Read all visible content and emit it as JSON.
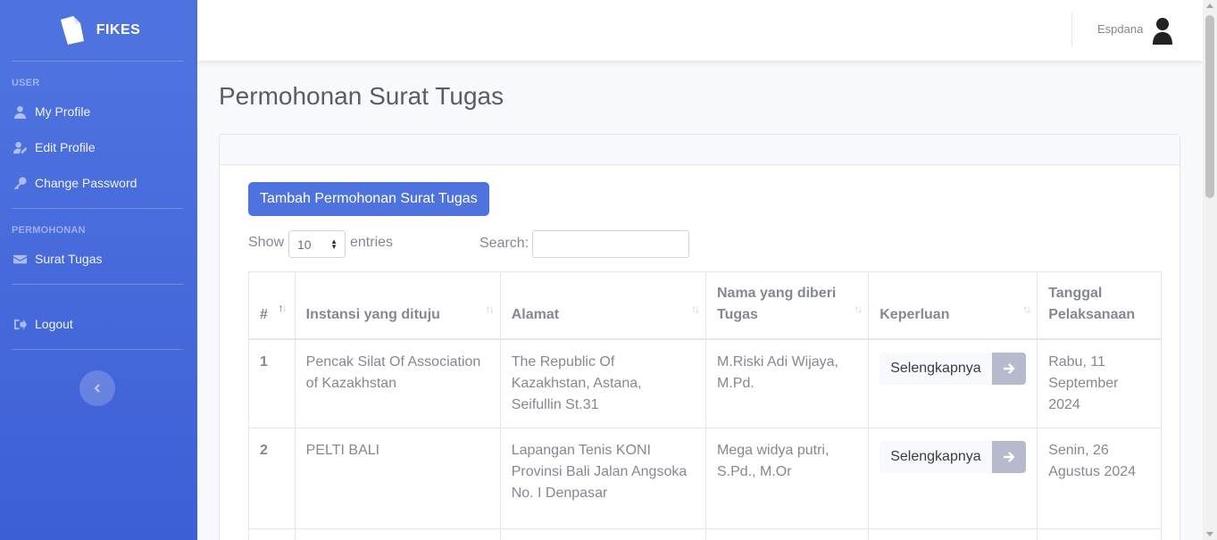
{
  "sidebar": {
    "brand": "FIKES",
    "sections": [
      {
        "heading": "USER",
        "items": [
          {
            "label": "My Profile",
            "icon": "user-icon"
          },
          {
            "label": "Edit Profile",
            "icon": "user-edit-icon"
          },
          {
            "label": "Change Password",
            "icon": "key-icon"
          }
        ]
      },
      {
        "heading": "PERMOHONAN",
        "items": [
          {
            "label": "Surat Tugas",
            "icon": "envelope-icon"
          }
        ]
      }
    ],
    "logout": "Logout",
    "toggle_icon": "chevron-left-icon"
  },
  "topbar": {
    "user_name": "Espdana",
    "avatar_icon": "user-avatar-icon"
  },
  "main": {
    "title": "Permohonan Surat Tugas",
    "add_button": "Tambah Permohonan Surat Tugas",
    "length": {
      "show": "Show",
      "value": "10",
      "entries": "entries"
    },
    "search": {
      "label": "Search:",
      "value": ""
    },
    "table": {
      "columns": [
        "#",
        "Instansi yang dituju",
        "Alamat",
        "Nama yang diberi Tugas",
        "Keperluan",
        "Tanggal Pelaksanaan"
      ],
      "rows": [
        {
          "no": "1",
          "instansi": "Pencak Silat Of Association of Kazakhstan",
          "alamat": "The Republic Of Kazakhstan, Astana, Seifullin St.31",
          "nama": "M.Riski Adi Wijaya, M.Pd.",
          "keperluan": "Selengkapnya",
          "tanggal": "Rabu, 11 September 2024"
        },
        {
          "no": "2",
          "instansi": "PELTI BALI",
          "alamat": "Lapangan Tenis KONI Provinsi Bali Jalan Angsoka No. I Denpasar",
          "nama": "Mega widya putri, S.Pd., M.Or",
          "keperluan": "Selengkapnya",
          "tanggal": "Senin, 26 Agustus 2024"
        }
      ]
    }
  },
  "colors": {
    "primary": "#4e73df",
    "text": "#858796",
    "heading": "#5a5c69"
  }
}
